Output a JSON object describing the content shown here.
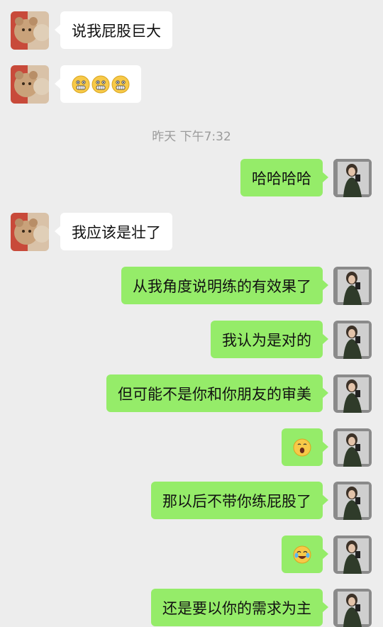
{
  "messages": [
    {
      "side": "left",
      "text": "说我屁股巨大"
    },
    {
      "side": "left",
      "emoji": [
        "grimacing-face",
        "grimacing-face",
        "grimacing-face"
      ]
    },
    {
      "side": "right",
      "text": "哈哈哈哈"
    },
    {
      "side": "left",
      "text": "我应该是壮了"
    },
    {
      "side": "right",
      "text": "从我角度说明练的有效果了"
    },
    {
      "side": "right",
      "text": "我认为是对的"
    },
    {
      "side": "right",
      "text": "但可能不是你和你朋友的审美"
    },
    {
      "side": "right",
      "emoji": [
        "shocked-face"
      ]
    },
    {
      "side": "right",
      "text": "那以后不带你练屁股了"
    },
    {
      "side": "right",
      "emoji": [
        "tears-of-joy-face"
      ]
    },
    {
      "side": "right",
      "text": "还是要以你的需求为主"
    }
  ],
  "timestamp": "昨天 下午7:32",
  "colors": {
    "background": "#ededed",
    "self_bubble": "#95ec69",
    "other_bubble": "#ffffff"
  }
}
